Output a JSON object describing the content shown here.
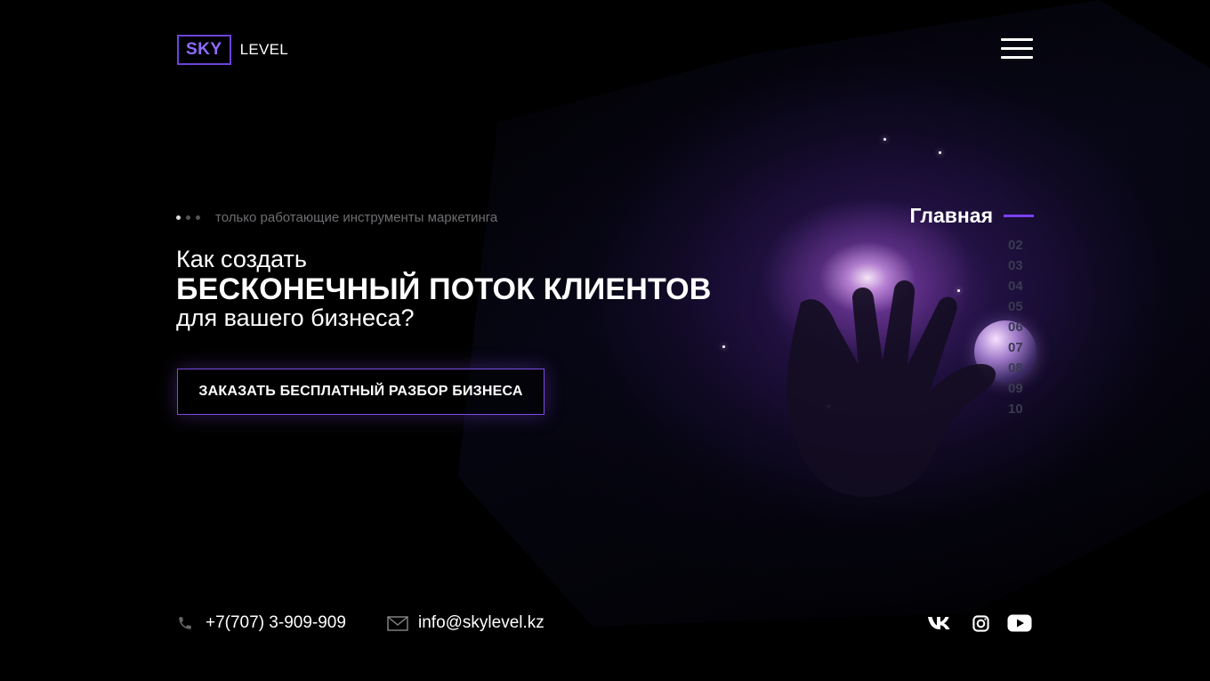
{
  "header": {
    "logo_box": "SKY",
    "logo_text": "LEVEL",
    "menu_icon": "hamburger-menu-icon"
  },
  "hero": {
    "tagline": "только работающие инструменты маркетинга",
    "slider_dots": 3,
    "active_dot": 1,
    "heading_pre": "Как создать",
    "heading_main": "БЕСКОНЕЧНЫЙ ПОТОК КЛИЕНТОВ",
    "heading_post": "для вашего бизнеса?",
    "cta_label": "ЗАКАЗАТЬ БЕСПЛАТНЫЙ РАЗБОР БИЗНЕСА"
  },
  "section_nav": {
    "current": "Главная",
    "items": [
      "02",
      "03",
      "04",
      "05",
      "06",
      "07",
      "08",
      "09",
      "10"
    ]
  },
  "footer": {
    "phone": "+7(707) 3-909-909",
    "phone_icon": "phone-icon",
    "email": "info@skylevel.kz",
    "email_icon": "envelope-icon",
    "socials": [
      "vk-icon",
      "instagram-icon",
      "youtube-icon"
    ]
  },
  "colors": {
    "background": "#000000",
    "accent": "#7a3ff0",
    "logo_border": "#6c43d9",
    "muted_text": "#6e6e72",
    "nav_inactive": "#3a3a50"
  }
}
